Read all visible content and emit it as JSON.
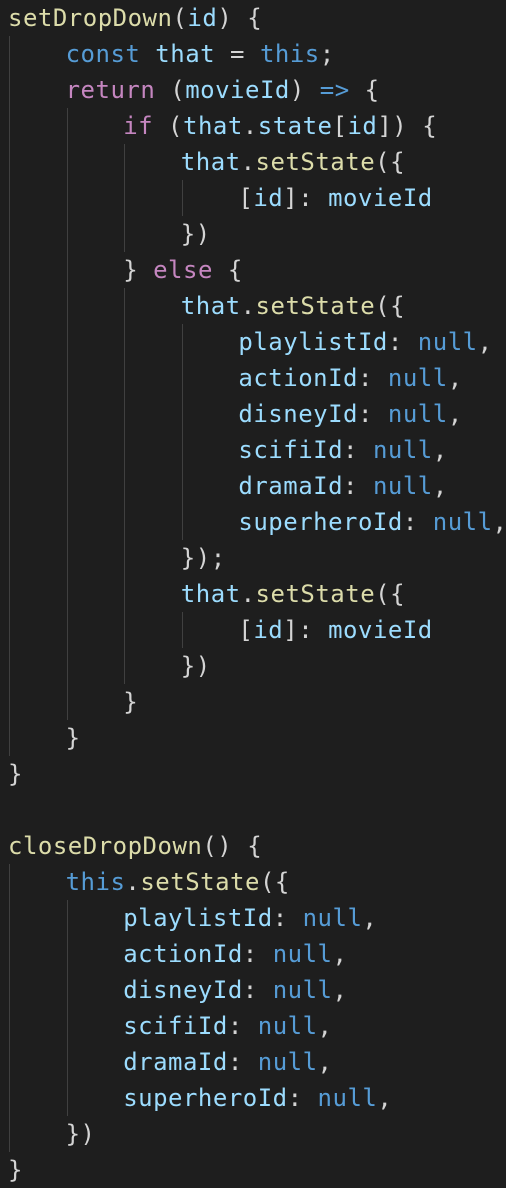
{
  "editor": {
    "theme_colors": {
      "background": "#1e1e1e",
      "function": "#dcdcaa",
      "variable": "#9cdcfe",
      "keyword": "#569cd6",
      "control": "#c586c0",
      "punctuation": "#d4d4d4",
      "indent_guide": "#404040"
    },
    "lines": [
      {
        "indent": 0,
        "tokens": [
          {
            "t": "setDropDown",
            "c": "fn"
          },
          {
            "t": "(",
            "c": "p"
          },
          {
            "t": "id",
            "c": "var"
          },
          {
            "t": ") {",
            "c": "p"
          }
        ]
      },
      {
        "indent": 1,
        "tokens": [
          {
            "t": "const",
            "c": "kw"
          },
          {
            "t": " ",
            "c": "p"
          },
          {
            "t": "that",
            "c": "var"
          },
          {
            "t": " = ",
            "c": "p"
          },
          {
            "t": "this",
            "c": "kw"
          },
          {
            "t": ";",
            "c": "p"
          }
        ]
      },
      {
        "indent": 1,
        "tokens": [
          {
            "t": "return",
            "c": "ctl"
          },
          {
            "t": " (",
            "c": "p"
          },
          {
            "t": "movieId",
            "c": "var"
          },
          {
            "t": ") ",
            "c": "p"
          },
          {
            "t": "=>",
            "c": "kw"
          },
          {
            "t": " {",
            "c": "p"
          }
        ]
      },
      {
        "indent": 2,
        "tokens": [
          {
            "t": "if",
            "c": "ctl"
          },
          {
            "t": " (",
            "c": "p"
          },
          {
            "t": "that",
            "c": "var"
          },
          {
            "t": ".",
            "c": "p"
          },
          {
            "t": "state",
            "c": "var"
          },
          {
            "t": "[",
            "c": "p"
          },
          {
            "t": "id",
            "c": "var"
          },
          {
            "t": "]) {",
            "c": "p"
          }
        ]
      },
      {
        "indent": 3,
        "tokens": [
          {
            "t": "that",
            "c": "var"
          },
          {
            "t": ".",
            "c": "p"
          },
          {
            "t": "setState",
            "c": "fn"
          },
          {
            "t": "({",
            "c": "p"
          }
        ]
      },
      {
        "indent": 4,
        "tokens": [
          {
            "t": "[",
            "c": "p"
          },
          {
            "t": "id",
            "c": "var"
          },
          {
            "t": "]: ",
            "c": "p"
          },
          {
            "t": "movieId",
            "c": "var"
          }
        ]
      },
      {
        "indent": 3,
        "tokens": [
          {
            "t": "})",
            "c": "p"
          }
        ]
      },
      {
        "indent": 2,
        "tokens": [
          {
            "t": "} ",
            "c": "p"
          },
          {
            "t": "else",
            "c": "ctl"
          },
          {
            "t": " {",
            "c": "p"
          }
        ]
      },
      {
        "indent": 3,
        "tokens": [
          {
            "t": "that",
            "c": "var"
          },
          {
            "t": ".",
            "c": "p"
          },
          {
            "t": "setState",
            "c": "fn"
          },
          {
            "t": "({",
            "c": "p"
          }
        ]
      },
      {
        "indent": 4,
        "tokens": [
          {
            "t": "playlistId",
            "c": "var"
          },
          {
            "t": ": ",
            "c": "p"
          },
          {
            "t": "null",
            "c": "kw"
          },
          {
            "t": ",",
            "c": "p"
          }
        ]
      },
      {
        "indent": 4,
        "tokens": [
          {
            "t": "actionId",
            "c": "var"
          },
          {
            "t": ": ",
            "c": "p"
          },
          {
            "t": "null",
            "c": "kw"
          },
          {
            "t": ",",
            "c": "p"
          }
        ]
      },
      {
        "indent": 4,
        "tokens": [
          {
            "t": "disneyId",
            "c": "var"
          },
          {
            "t": ": ",
            "c": "p"
          },
          {
            "t": "null",
            "c": "kw"
          },
          {
            "t": ",",
            "c": "p"
          }
        ]
      },
      {
        "indent": 4,
        "tokens": [
          {
            "t": "scifiId",
            "c": "var"
          },
          {
            "t": ": ",
            "c": "p"
          },
          {
            "t": "null",
            "c": "kw"
          },
          {
            "t": ",",
            "c": "p"
          }
        ]
      },
      {
        "indent": 4,
        "tokens": [
          {
            "t": "dramaId",
            "c": "var"
          },
          {
            "t": ": ",
            "c": "p"
          },
          {
            "t": "null",
            "c": "kw"
          },
          {
            "t": ",",
            "c": "p"
          }
        ]
      },
      {
        "indent": 4,
        "tokens": [
          {
            "t": "superheroId",
            "c": "var"
          },
          {
            "t": ": ",
            "c": "p"
          },
          {
            "t": "null",
            "c": "kw"
          },
          {
            "t": ",",
            "c": "p"
          }
        ]
      },
      {
        "indent": 3,
        "tokens": [
          {
            "t": "});",
            "c": "p"
          }
        ]
      },
      {
        "indent": 3,
        "tokens": [
          {
            "t": "that",
            "c": "var"
          },
          {
            "t": ".",
            "c": "p"
          },
          {
            "t": "setState",
            "c": "fn"
          },
          {
            "t": "({",
            "c": "p"
          }
        ]
      },
      {
        "indent": 4,
        "tokens": [
          {
            "t": "[",
            "c": "p"
          },
          {
            "t": "id",
            "c": "var"
          },
          {
            "t": "]: ",
            "c": "p"
          },
          {
            "t": "movieId",
            "c": "var"
          }
        ]
      },
      {
        "indent": 3,
        "tokens": [
          {
            "t": "})",
            "c": "p"
          }
        ]
      },
      {
        "indent": 2,
        "tokens": [
          {
            "t": "}",
            "c": "p"
          }
        ]
      },
      {
        "indent": 1,
        "tokens": [
          {
            "t": "}",
            "c": "p"
          }
        ]
      },
      {
        "indent": 0,
        "tokens": [
          {
            "t": "}",
            "c": "p"
          }
        ]
      },
      {
        "indent": 0,
        "tokens": []
      },
      {
        "indent": 0,
        "tokens": [
          {
            "t": "closeDropDown",
            "c": "fn"
          },
          {
            "t": "() {",
            "c": "p"
          }
        ]
      },
      {
        "indent": 1,
        "tokens": [
          {
            "t": "this",
            "c": "kw"
          },
          {
            "t": ".",
            "c": "p"
          },
          {
            "t": "setState",
            "c": "fn"
          },
          {
            "t": "({",
            "c": "p"
          }
        ]
      },
      {
        "indent": 2,
        "tokens": [
          {
            "t": "playlistId",
            "c": "var"
          },
          {
            "t": ": ",
            "c": "p"
          },
          {
            "t": "null",
            "c": "kw"
          },
          {
            "t": ",",
            "c": "p"
          }
        ]
      },
      {
        "indent": 2,
        "tokens": [
          {
            "t": "actionId",
            "c": "var"
          },
          {
            "t": ": ",
            "c": "p"
          },
          {
            "t": "null",
            "c": "kw"
          },
          {
            "t": ",",
            "c": "p"
          }
        ]
      },
      {
        "indent": 2,
        "tokens": [
          {
            "t": "disneyId",
            "c": "var"
          },
          {
            "t": ": ",
            "c": "p"
          },
          {
            "t": "null",
            "c": "kw"
          },
          {
            "t": ",",
            "c": "p"
          }
        ]
      },
      {
        "indent": 2,
        "tokens": [
          {
            "t": "scifiId",
            "c": "var"
          },
          {
            "t": ": ",
            "c": "p"
          },
          {
            "t": "null",
            "c": "kw"
          },
          {
            "t": ",",
            "c": "p"
          }
        ]
      },
      {
        "indent": 2,
        "tokens": [
          {
            "t": "dramaId",
            "c": "var"
          },
          {
            "t": ": ",
            "c": "p"
          },
          {
            "t": "null",
            "c": "kw"
          },
          {
            "t": ",",
            "c": "p"
          }
        ]
      },
      {
        "indent": 2,
        "tokens": [
          {
            "t": "superheroId",
            "c": "var"
          },
          {
            "t": ": ",
            "c": "p"
          },
          {
            "t": "null",
            "c": "kw"
          },
          {
            "t": ",",
            "c": "p"
          }
        ]
      },
      {
        "indent": 1,
        "tokens": [
          {
            "t": "})",
            "c": "p"
          }
        ]
      },
      {
        "indent": 0,
        "tokens": [
          {
            "t": "}",
            "c": "p"
          }
        ]
      }
    ]
  }
}
